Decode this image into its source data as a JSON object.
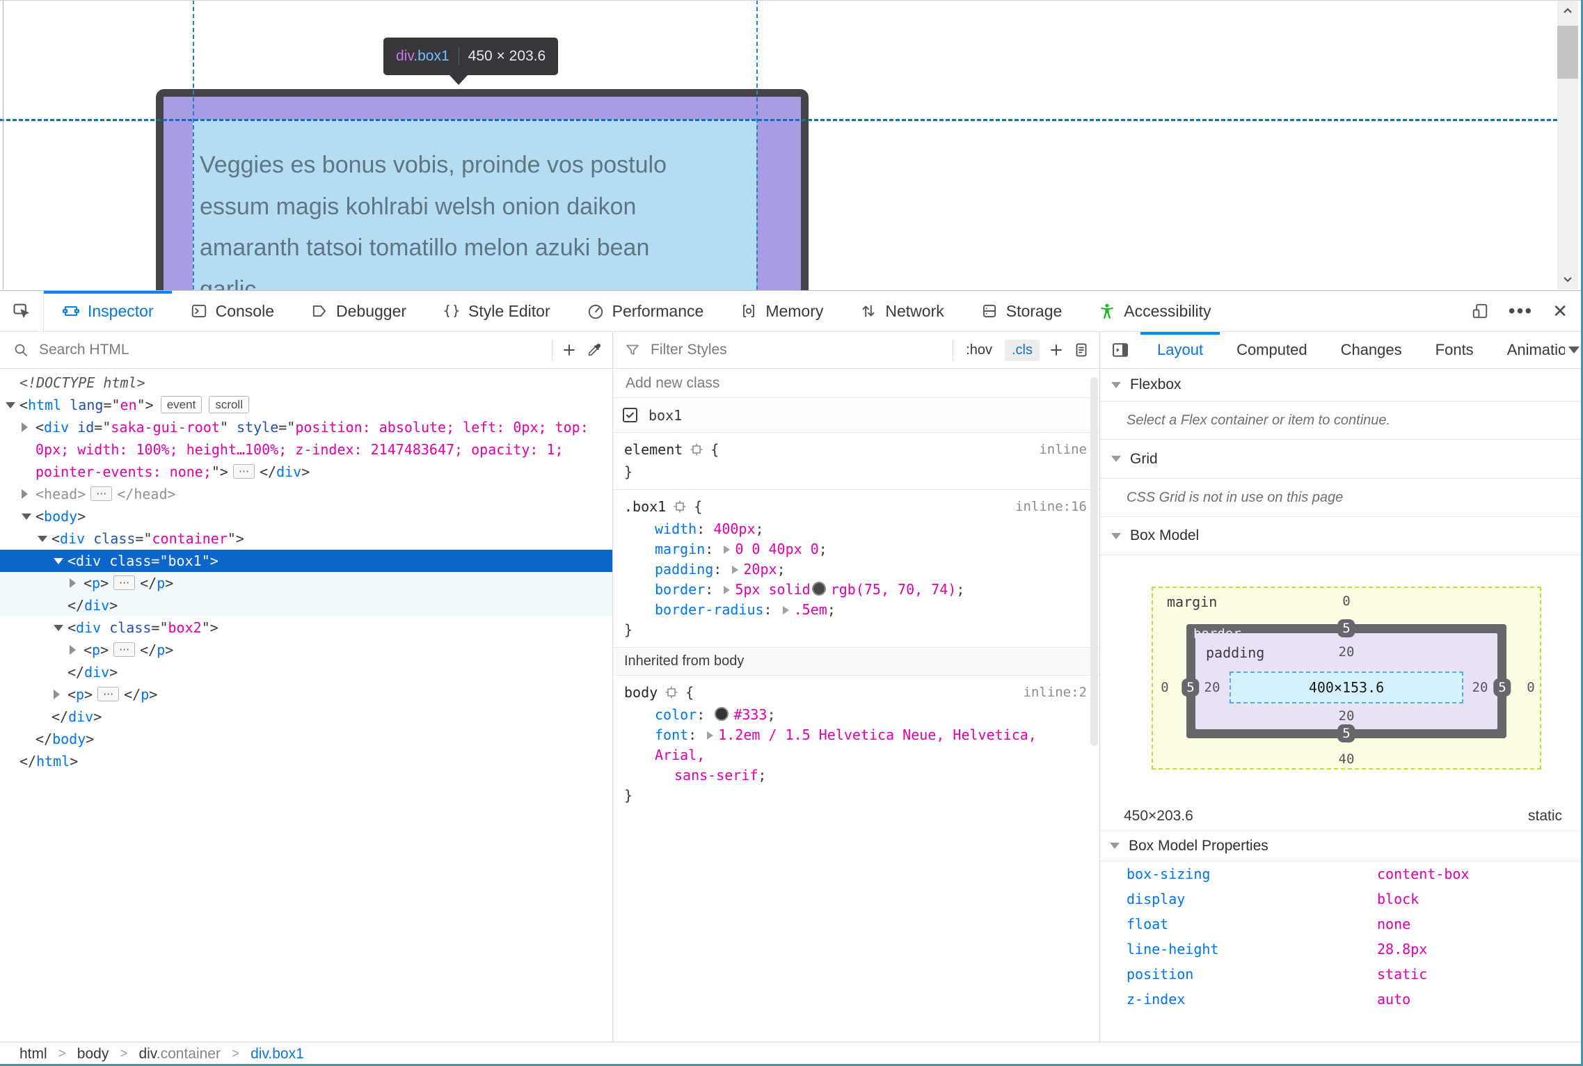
{
  "page": {
    "tooltip": {
      "tag": "div",
      "cls": ".box1",
      "dims": "450 × 203.6"
    },
    "body_lines": [
      "Veggies es bonus vobis, proinde vos postulo",
      "essum magis kohlrabi welsh onion daikon",
      "amaranth tatsoi tomatillo melon azuki bean",
      "garlic."
    ]
  },
  "tabbar": {
    "tabs": [
      {
        "label": "Inspector",
        "icon": "inspector",
        "active": true
      },
      {
        "label": "Console",
        "icon": "console"
      },
      {
        "label": "Debugger",
        "icon": "debugger"
      },
      {
        "label": "Style Editor",
        "icon": "styleeditor"
      },
      {
        "label": "Performance",
        "icon": "performance"
      },
      {
        "label": "Memory",
        "icon": "memory"
      },
      {
        "label": "Network",
        "icon": "network"
      },
      {
        "label": "Storage",
        "icon": "storage"
      },
      {
        "label": "Accessibility",
        "icon": "accessibility",
        "color": "#23b525"
      }
    ]
  },
  "toolbar": {
    "search_placeholder": "Search HTML",
    "filter_placeholder": "Filter Styles",
    "pseudo_label": ":hov",
    "class_label": ".cls",
    "sidebar_tabs": [
      {
        "label": "Layout",
        "active": true
      },
      {
        "label": "Computed"
      },
      {
        "label": "Changes"
      },
      {
        "label": "Fonts"
      },
      {
        "label": "Animations"
      }
    ]
  },
  "markup": {
    "rows": [
      {
        "lvl": 0,
        "segs": [
          [
            "doct",
            "<!DOCTYPE html>"
          ]
        ]
      },
      {
        "lvl": 0,
        "arrow": "open",
        "segs": [
          [
            "pu",
            "<"
          ],
          [
            "tag",
            "html"
          ],
          [
            "attr",
            " lang"
          ],
          [
            "pu",
            "=\""
          ],
          [
            "val",
            "en"
          ],
          [
            "pu",
            "\">"
          ],
          [
            "badge",
            "event"
          ],
          [
            "badge",
            "scroll"
          ]
        ]
      },
      {
        "lvl": 1,
        "arrow": "closed",
        "segs": [
          [
            "pu",
            "<"
          ],
          [
            "tag",
            "div"
          ],
          [
            "attr",
            " id"
          ],
          [
            "pu",
            "=\""
          ],
          [
            "val",
            "saka-gui-root"
          ],
          [
            "pu",
            "\""
          ],
          [
            "attr",
            " style"
          ],
          [
            "pu",
            "=\""
          ],
          [
            "val",
            "position: absolute; left: 0px; top:"
          ]
        ]
      },
      {
        "lvl": 1,
        "cont": true,
        "segs": [
          [
            "val",
            "0px; width: 100%; height…100%; z-index: 2147483647; opacity: 1;"
          ]
        ]
      },
      {
        "lvl": 1,
        "cont": true,
        "segs": [
          [
            "val",
            "pointer-events: none;"
          ],
          [
            "pu",
            "\">"
          ],
          [
            "dots",
            "⋯"
          ],
          [
            "pu",
            "</"
          ],
          [
            "tag",
            "div"
          ],
          [
            "pu",
            ">"
          ]
        ]
      },
      {
        "lvl": 1,
        "arrow": "closed",
        "segs": [
          [
            "gray",
            "<head>"
          ],
          [
            "dots",
            "⋯"
          ],
          [
            "gray",
            "</head>"
          ]
        ]
      },
      {
        "lvl": 1,
        "arrow": "open",
        "segs": [
          [
            "pu",
            "<"
          ],
          [
            "tag",
            "body"
          ],
          [
            "pu",
            ">"
          ]
        ]
      },
      {
        "lvl": 2,
        "arrow": "open",
        "segs": [
          [
            "pu",
            "<"
          ],
          [
            "tag",
            "div"
          ],
          [
            "attr",
            " class"
          ],
          [
            "pu",
            "=\""
          ],
          [
            "val",
            "container"
          ],
          [
            "pu",
            "\">"
          ]
        ]
      },
      {
        "lvl": 3,
        "arrow": "open",
        "sel": true,
        "segs": [
          [
            "pu",
            "<"
          ],
          [
            "tag",
            "div"
          ],
          [
            "attr",
            " class"
          ],
          [
            "pu",
            "=\""
          ],
          [
            "val",
            "box1"
          ],
          [
            "pu",
            "\">"
          ]
        ]
      },
      {
        "lvl": 4,
        "arrow": "closed",
        "hl": true,
        "segs": [
          [
            "pu",
            "<"
          ],
          [
            "tag",
            "p"
          ],
          [
            "pu",
            ">"
          ],
          [
            "dots",
            "⋯"
          ],
          [
            "pu",
            "</"
          ],
          [
            "tag",
            "p"
          ],
          [
            "pu",
            ">"
          ]
        ]
      },
      {
        "lvl": 3,
        "close": true,
        "hl": true,
        "segs": [
          [
            "pu",
            "</"
          ],
          [
            "tag",
            "div"
          ],
          [
            "pu",
            ">"
          ]
        ]
      },
      {
        "lvl": 3,
        "arrow": "open",
        "segs": [
          [
            "pu",
            "<"
          ],
          [
            "tag",
            "div"
          ],
          [
            "attr",
            " class"
          ],
          [
            "pu",
            "=\""
          ],
          [
            "val",
            "box2"
          ],
          [
            "pu",
            "\">"
          ]
        ]
      },
      {
        "lvl": 4,
        "arrow": "closed",
        "segs": [
          [
            "pu",
            "<"
          ],
          [
            "tag",
            "p"
          ],
          [
            "pu",
            ">"
          ],
          [
            "dots",
            "⋯"
          ],
          [
            "pu",
            "</"
          ],
          [
            "tag",
            "p"
          ],
          [
            "pu",
            ">"
          ]
        ]
      },
      {
        "lvl": 3,
        "close": true,
        "segs": [
          [
            "pu",
            "</"
          ],
          [
            "tag",
            "div"
          ],
          [
            "pu",
            ">"
          ]
        ]
      },
      {
        "lvl": 3,
        "arrow": "closed",
        "segs": [
          [
            "pu",
            "<"
          ],
          [
            "tag",
            "p"
          ],
          [
            "pu",
            ">"
          ],
          [
            "dots",
            "⋯"
          ],
          [
            "pu",
            "</"
          ],
          [
            "tag",
            "p"
          ],
          [
            "pu",
            ">"
          ]
        ]
      },
      {
        "lvl": 2,
        "close": true,
        "segs": [
          [
            "pu",
            "</"
          ],
          [
            "tag",
            "div"
          ],
          [
            "pu",
            ">"
          ]
        ]
      },
      {
        "lvl": 1,
        "close": true,
        "segs": [
          [
            "pu",
            "</"
          ],
          [
            "tag",
            "body"
          ],
          [
            "pu",
            ">"
          ]
        ]
      },
      {
        "lvl": 0,
        "close": true,
        "segs": [
          [
            "pu",
            "</"
          ],
          [
            "tag",
            "html"
          ],
          [
            "pu",
            ">"
          ]
        ]
      }
    ]
  },
  "rules": {
    "add_class_placeholder": "Add new class",
    "class_toggle": {
      "checked": true,
      "label": "box1"
    },
    "blocks": [
      {
        "selector": "element",
        "link": "inline",
        "decls": []
      },
      {
        "selector": ".box1",
        "link": "inline:16",
        "decls": [
          {
            "n": "width",
            "arrow": false,
            "parts": [
              [
                "v",
                "400px"
              ]
            ]
          },
          {
            "n": "margin",
            "arrow": true,
            "parts": [
              [
                "v",
                "0 0 40px 0"
              ]
            ]
          },
          {
            "n": "padding",
            "arrow": true,
            "parts": [
              [
                "v",
                "20px"
              ]
            ]
          },
          {
            "n": "border",
            "arrow": true,
            "parts": [
              [
                "v",
                "5px solid"
              ],
              [
                "swatch",
                "#4b464a"
              ],
              [
                "v",
                "rgb(75, 70, 74)"
              ]
            ]
          },
          {
            "n": "border-radius",
            "arrow": true,
            "parts": [
              [
                "v",
                ".5em"
              ]
            ]
          }
        ]
      }
    ],
    "inherited_label": "Inherited from body",
    "inherited_blocks": [
      {
        "selector": "body",
        "link": "inline:2",
        "decls": [
          {
            "n": "color",
            "arrow": false,
            "parts": [
              [
                "swatch",
                "#333333"
              ],
              [
                "v",
                "#333"
              ]
            ]
          },
          {
            "n": "font",
            "arrow": true,
            "parts": [
              [
                "v",
                "1.2em / 1.5 Helvetica Neue, Helvetica, Arial,"
              ]
            ],
            "wrap": "sans-serif"
          }
        ]
      }
    ]
  },
  "layout": {
    "flexbox_title": "Flexbox",
    "flexbox_msg": "Select a Flex container or item to continue.",
    "grid_title": "Grid",
    "grid_msg": "CSS Grid is not in use on this page",
    "boxmodel_title": "Box Model",
    "bm": {
      "label_margin": "margin",
      "label_border": "border",
      "label_padding": "padding",
      "m_top": "0",
      "m_right": "0",
      "m_bottom": "40",
      "m_left": "0",
      "b_top": "5",
      "b_right": "5",
      "b_bottom": "5",
      "b_left": "5",
      "p_top": "20",
      "p_right": "20",
      "p_bottom": "20",
      "p_left": "20",
      "content": "400×153.6"
    },
    "dims": "450×203.6",
    "position": "static",
    "props_title": "Box Model Properties",
    "props": [
      {
        "n": "box-sizing",
        "v": "content-box"
      },
      {
        "n": "display",
        "v": "block"
      },
      {
        "n": "float",
        "v": "none"
      },
      {
        "n": "line-height",
        "v": "28.8px"
      },
      {
        "n": "position",
        "v": "static"
      },
      {
        "n": "z-index",
        "v": "auto"
      }
    ]
  },
  "breadcrumb": {
    "items": [
      {
        "t": "html"
      },
      {
        "t": "body"
      },
      {
        "t": "div",
        "c": ".container"
      },
      {
        "t": "div.box1",
        "active": true
      }
    ]
  }
}
